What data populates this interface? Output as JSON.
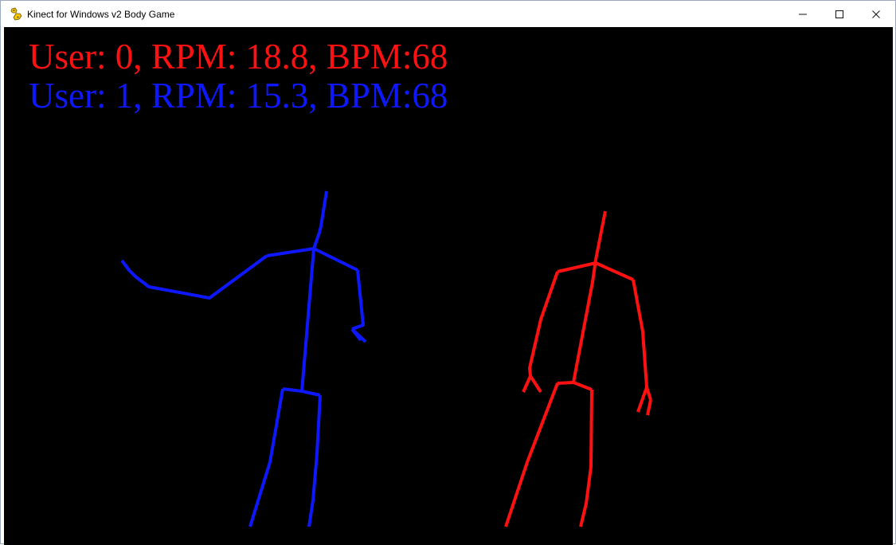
{
  "window": {
    "title": "Kinect for Windows v2 Body Game",
    "app_icon": "python-icon",
    "buttons": {
      "minimize_icon": "minimize-icon",
      "maximize_icon": "maximize-icon",
      "close_icon": "close-icon"
    }
  },
  "game": {
    "background_color": "#000000",
    "users": [
      {
        "text": "User: 0, RPM: 18.8, BPM:68",
        "color": "#ff1111",
        "skeleton": "red-stick-figure"
      },
      {
        "text": "User: 1, RPM: 15.3, BPM:68",
        "color": "#0d18ff",
        "skeleton": "blue-stick-figure"
      }
    ]
  }
}
